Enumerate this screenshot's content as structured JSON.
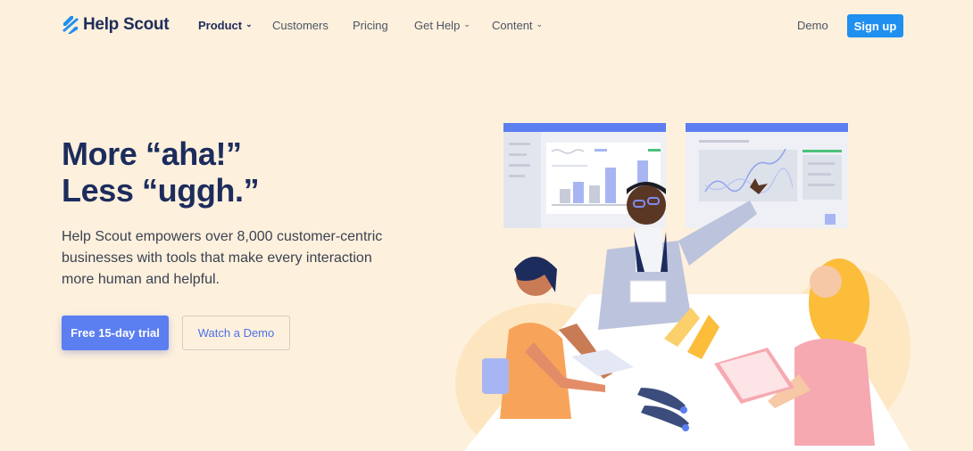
{
  "nav": {
    "logo_text": "Help Scout",
    "items": [
      {
        "label": "Product",
        "has_menu": true
      },
      {
        "label": "Customers",
        "has_menu": false
      },
      {
        "label": "Pricing",
        "has_menu": false
      },
      {
        "label": "Get Help",
        "has_menu": true
      },
      {
        "label": "Content",
        "has_menu": true
      }
    ],
    "demo_label": "Demo",
    "signup_label": "Sign up"
  },
  "hero": {
    "headline_line1": "More “aha!”",
    "headline_line2": "Less “uggh.”",
    "lede": "Help Scout empowers over 8,000 customer-centric businesses with tools that make every interaction more human and helpful.",
    "trial_label": "Free 15-day trial",
    "watch_demo_label": "Watch a Demo"
  },
  "colors": {
    "background": "#fdf0dd",
    "brand_blue": "#1f8ff0",
    "cta_blue": "#5b7ef0",
    "navy": "#1c2c5c"
  },
  "icons": {
    "logo": "helpscout-logo-icon",
    "chevron": "chevron-down-icon"
  }
}
